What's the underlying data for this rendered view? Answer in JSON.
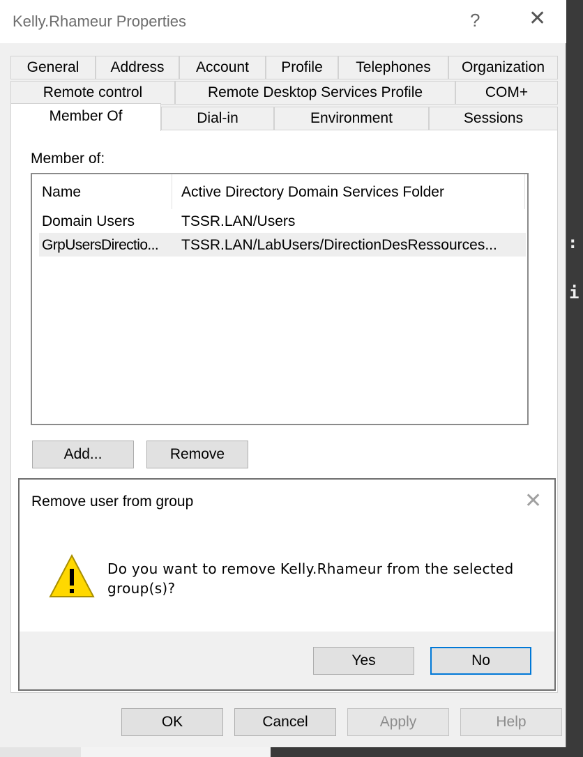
{
  "window": {
    "title": "Kelly.Rhameur Properties",
    "help_glyph": "?",
    "close_glyph": "✕"
  },
  "tabs": {
    "row1": [
      "General",
      "Address",
      "Account",
      "Profile",
      "Telephones",
      "Organization"
    ],
    "row2": [
      "Remote control",
      "Remote Desktop Services Profile",
      "COM+"
    ],
    "row3": [
      "Member Of",
      "Dial-in",
      "Environment",
      "Sessions"
    ],
    "active": "Member Of"
  },
  "member_of": {
    "label": "Member of:",
    "columns": [
      "Name",
      "Active Directory Domain Services Folder"
    ],
    "rows": [
      {
        "name": "Domain Users",
        "folder": "TSSR.LAN/Users"
      },
      {
        "name": "GrpUsersDirectio...",
        "folder": "TSSR.LAN/LabUsers/DirectionDesRessources..."
      }
    ],
    "selected_row": 1
  },
  "group_buttons": {
    "add": "Add...",
    "remove": "Remove"
  },
  "dialog": {
    "title": "Remove user from group",
    "close_glyph": "✕",
    "message": "Do you want to remove Kelly.Rhameur from the selected group(s)?",
    "icon": "warning-icon",
    "yes": "Yes",
    "no": "No"
  },
  "footer_buttons": {
    "ok": "OK",
    "cancel": "Cancel",
    "apply": "Apply",
    "help": "Help"
  },
  "background": {
    "glyph_1": ":",
    "glyph_2": "i"
  },
  "colors": {
    "focus_border": "#0078d7",
    "warning_fill": "#ffd800"
  }
}
